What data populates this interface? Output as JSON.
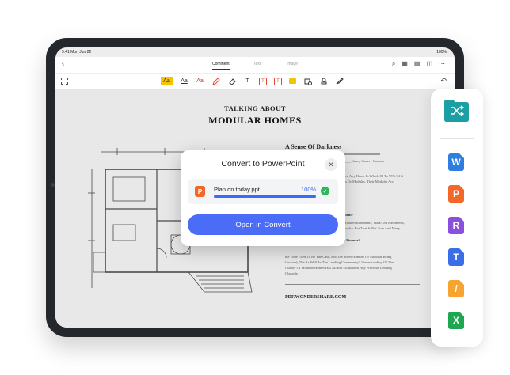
{
  "statusbar": {
    "time": "9:41 Mon Jun 22",
    "right": "100%"
  },
  "toolbar": {
    "back_icon": "chevron-left-icon",
    "tabs": [
      {
        "label": "Comment",
        "active": true
      },
      {
        "label": "Text",
        "active": false
      },
      {
        "label": "Image",
        "active": false
      }
    ],
    "right_icons": [
      "search-icon",
      "grid-icon",
      "document-icon",
      "book-icon",
      "more-icon"
    ]
  },
  "annotation_tools": {
    "highlight": "Aa",
    "underline": "Aa",
    "strikethrough": "Aa",
    "textbox": "T",
    "items": [
      "highlight-icon",
      "underline-icon",
      "strikethrough-icon",
      "pen-icon",
      "eraser-icon",
      "text-icon",
      "textbox-icon",
      "callout-icon",
      "sticky-note-icon",
      "shape-icon",
      "stamp-icon",
      "signature-icon"
    ],
    "undo_icon": "undo-icon",
    "accent": "#f5c400"
  },
  "document": {
    "title_line1": "TALKING ABOUT",
    "title_line2": "MODULAR HOMES",
    "section_heading": "A Sense Of Darkness",
    "fragments": {
      "line1": "mes_____Nancy Storrs - Custom",
      "line2": "hines.",
      "line3": "mes Are Any Home In Which 80 To 95% Of It",
      "line4": "nctions Or Modules. Their Modular Arc",
      "q1": "Basement?",
      "q1a": "With Vaulted Basements, Walk-Out Basements,",
      "q1b": "per Levels - But That Is Not True And Many",
      "q2": "ult To Finance?",
      "para1": "ble Time Used To Be The Case, But The Sheer Number Of Modular Being",
      "para2": "Custom), The As Well As The Lending Community's Understanding Of The",
      "para3": "Quality Of Modular Homes Has All But Eliminated Any Previous Lending",
      "para4": "Obstacle."
    },
    "website": "PDF.WONDERSHARE.COM"
  },
  "dialog": {
    "title": "Convert to PowerPoint",
    "close_icon": "close-icon",
    "file_icon_letter": "P",
    "file_name": "Plan on today.ppt",
    "progress_label": "100%",
    "progress": 1.0,
    "status_icon": "checkmark-icon",
    "button_label": "Open in Convert",
    "accent": "#4a6cf7"
  },
  "sidebar": {
    "folder_icon": "shuffle-folder-icon",
    "apps": [
      {
        "name": "word-icon",
        "letter": "W",
        "color": "#2f7de1"
      },
      {
        "name": "powerpoint-icon",
        "letter": "P",
        "color": "#f2682a"
      },
      {
        "name": "r-doc-icon",
        "letter": "R",
        "color": "#8b4fe0"
      },
      {
        "name": "text-doc-icon",
        "letter": "T",
        "color": "#3a6de8"
      },
      {
        "name": "pages-icon",
        "letter": "/",
        "color": "#f7a431"
      },
      {
        "name": "excel-icon",
        "letter": "X",
        "color": "#1ea650"
      }
    ]
  }
}
